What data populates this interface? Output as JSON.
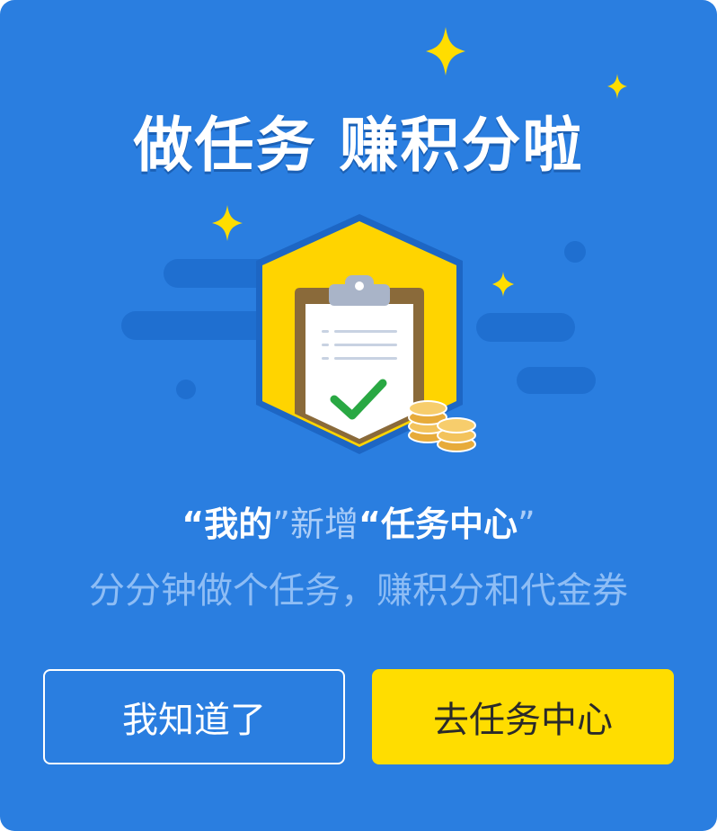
{
  "dialog": {
    "title": "做任务 赚积分啦",
    "notice": {
      "quote_open_1": "“",
      "tab_name": "我的",
      "quote_close_1": "”",
      "verb": "新增",
      "quote_open_2": "“",
      "feature_name": "任务中心",
      "quote_close_2": "”"
    },
    "subtitle": "分分钟做个任务，赚积分和代金券",
    "buttons": {
      "dismiss_label": "我知道了",
      "go_label": "去任务中心"
    }
  },
  "icons": [
    "sparkle-icon",
    "clipboard-icon",
    "checkmark-icon",
    "coins-icon",
    "cloud-icon"
  ],
  "colors": {
    "background": "#2a7ee0",
    "accent_yellow": "#ffdd00",
    "muted_text": "#8ebdf5"
  }
}
